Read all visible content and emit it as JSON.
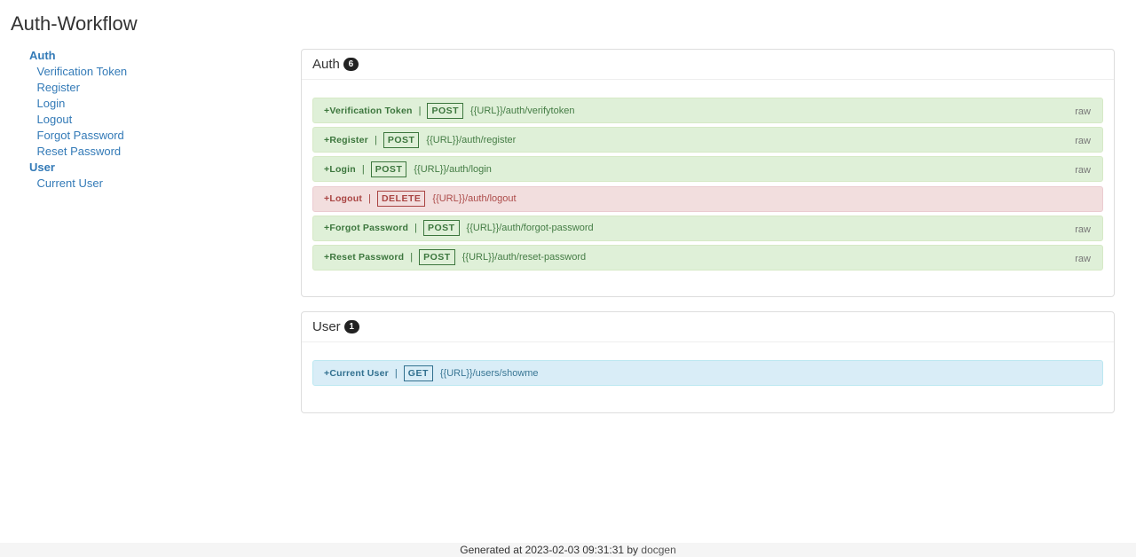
{
  "page": {
    "title": "Auth-Workflow"
  },
  "sidebar": {
    "groups": [
      {
        "label": "Auth",
        "items": [
          "Verification Token",
          "Register",
          "Login",
          "Logout",
          "Forgot Password",
          "Reset Password"
        ]
      },
      {
        "label": "User",
        "items": [
          "Current User"
        ]
      }
    ]
  },
  "sections": [
    {
      "title": "Auth",
      "count": "6",
      "endpoints": [
        {
          "name": "+Verification Token",
          "method": "POST",
          "path": "{{URL}}/auth/verifytoken",
          "raw": "raw",
          "kind": "post"
        },
        {
          "name": "+Register",
          "method": "POST",
          "path": "{{URL}}/auth/register",
          "raw": "raw",
          "kind": "post"
        },
        {
          "name": "+Login",
          "method": "POST",
          "path": "{{URL}}/auth/login",
          "raw": "raw",
          "kind": "post"
        },
        {
          "name": "+Logout",
          "method": "DELETE",
          "path": "{{URL}}/auth/logout",
          "raw": "",
          "kind": "delete"
        },
        {
          "name": "+Forgot Password",
          "method": "POST",
          "path": "{{URL}}/auth/forgot-password",
          "raw": "raw",
          "kind": "post"
        },
        {
          "name": "+Reset Password",
          "method": "POST",
          "path": "{{URL}}/auth/reset-password",
          "raw": "raw",
          "kind": "post"
        }
      ]
    },
    {
      "title": "User",
      "count": "1",
      "endpoints": [
        {
          "name": "+Current User",
          "method": "GET",
          "path": "{{URL}}/users/showme",
          "raw": "",
          "kind": "get"
        }
      ]
    }
  ],
  "footer": {
    "prefix": "Generated at 2023-02-03 09:31:31 by ",
    "link": "docgen"
  },
  "colors": {
    "link": "#337ab7",
    "post_bg": "#dff0d8",
    "delete_bg": "#f2dede",
    "get_bg": "#d9edf7"
  }
}
